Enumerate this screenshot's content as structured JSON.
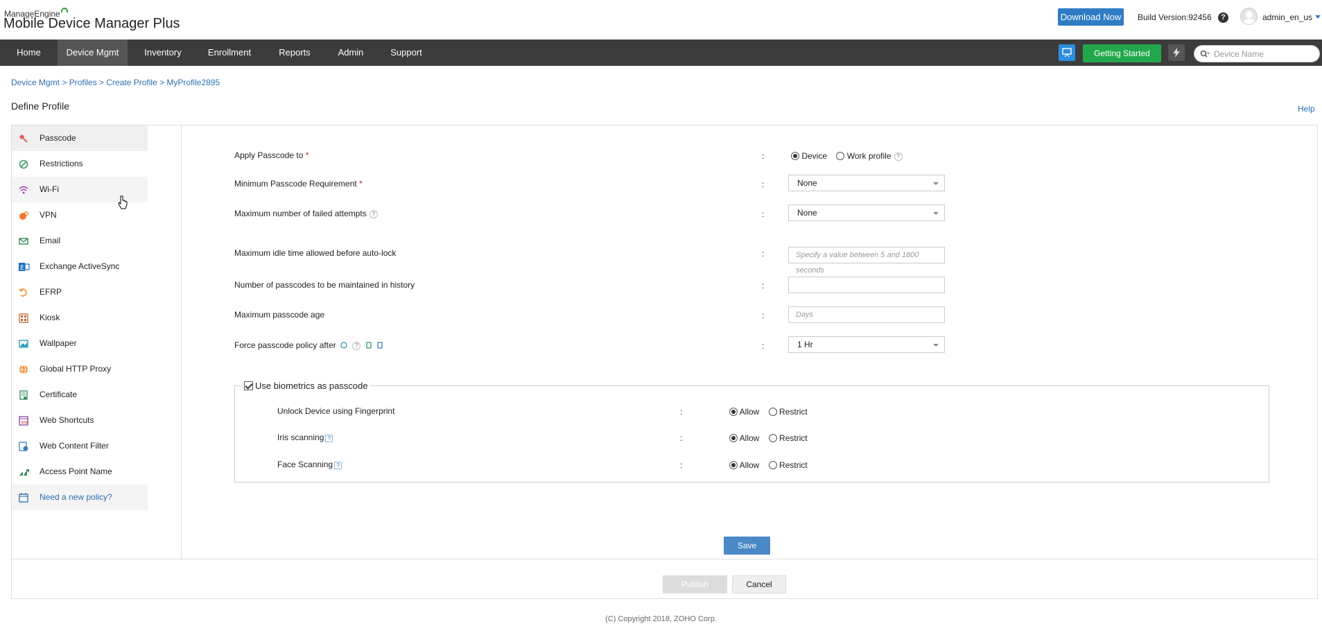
{
  "header": {
    "brand_top": "ManageEngine",
    "brand_name": "Mobile Device Manager Plus",
    "download_label": "Download Now",
    "build_version": "Build Version:92456",
    "help_icon": "help-icon",
    "user_name": "admin_en_us"
  },
  "nav": {
    "items": [
      "Home",
      "Device Mgmt",
      "Inventory",
      "Enrollment",
      "Reports",
      "Admin",
      "Support"
    ],
    "active": "Device Mgmt",
    "getting_started_label": "Getting Started",
    "search_placeholder": "Device Name"
  },
  "breadcrumb": "Device Mgmt > Profiles > Create Profile > MyProfile2895",
  "page_title": "Define Profile",
  "help_label": "Help",
  "sidebar": {
    "items": [
      {
        "label": "Passcode",
        "icon": "key-icon"
      },
      {
        "label": "Restrictions",
        "icon": "restriction-icon"
      },
      {
        "label": "Wi-Fi",
        "icon": "wifi-icon"
      },
      {
        "label": "VPN",
        "icon": "vpn-icon"
      },
      {
        "label": "Email",
        "icon": "email-icon"
      },
      {
        "label": "Exchange ActiveSync",
        "icon": "exchange-icon"
      },
      {
        "label": "EFRP",
        "icon": "efrp-icon"
      },
      {
        "label": "Kiosk",
        "icon": "kiosk-icon"
      },
      {
        "label": "Wallpaper",
        "icon": "wallpaper-icon"
      },
      {
        "label": "Global HTTP Proxy",
        "icon": "globe-icon"
      },
      {
        "label": "Certificate",
        "icon": "certificate-icon"
      },
      {
        "label": "Web Shortcuts",
        "icon": "web-shortcut-icon"
      },
      {
        "label": "Web Content Filter",
        "icon": "content-filter-icon"
      },
      {
        "label": "Access Point Name",
        "icon": "access-point-icon"
      },
      {
        "label": "Need a new policy?",
        "icon": "calendar-icon"
      }
    ],
    "active": "Passcode"
  },
  "form": {
    "apply_passcode_label": "Apply Passcode to",
    "apply_options": [
      "Device",
      "Work profile"
    ],
    "apply_selected": "Device",
    "min_req_label": "Minimum Passcode Requirement",
    "min_req_value": "None",
    "max_failed_label": "Maximum number of failed attempts",
    "max_failed_value": "None",
    "max_idle_label": "Maximum idle time allowed before auto-lock",
    "max_idle_placeholder": "Specify a value between 5 and 1800 seconds",
    "history_label": "Number of passcodes to be maintained in history",
    "history_value": "",
    "max_age_label": "Maximum passcode age",
    "max_age_placeholder": "Days",
    "force_label": "Force passcode policy after",
    "force_value": "1 Hr",
    "colon": ":",
    "required_mark": "*"
  },
  "biometrics": {
    "legend": "Use biometrics as passcode",
    "checked": true,
    "rows": [
      {
        "label": "Unlock Device using Fingerprint",
        "selected": "Allow"
      },
      {
        "label": "Iris scanning",
        "selected": "Allow"
      },
      {
        "label": "Face Scanning",
        "selected": "Allow"
      }
    ],
    "options": [
      "Allow",
      "Restrict"
    ]
  },
  "buttons": {
    "save": "Save",
    "publish": "Publish",
    "cancel": "Cancel"
  },
  "footer": {
    "copyright": "(C) Copyright 2018, ZOHO Corp."
  },
  "colors": {
    "nav_bg": "#3c3c3c",
    "accent_blue": "#2d7cc4",
    "getting_started_green": "#22a84a",
    "link_blue": "#2d6fb0",
    "required_red": "#d21c1c"
  }
}
